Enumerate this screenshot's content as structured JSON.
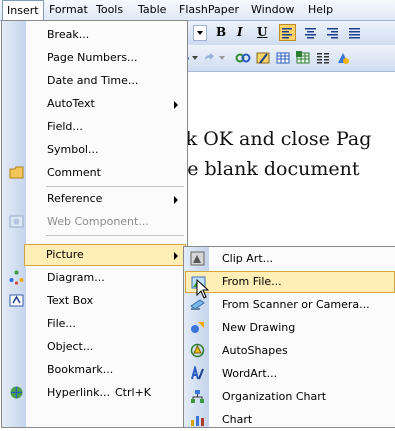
{
  "menubar": {
    "items": [
      "Insert",
      "Format",
      "Tools",
      "Table",
      "FlashPaper",
      "Window",
      "Help"
    ]
  },
  "toolbar": {
    "font_size_fragment": "2",
    "bold": "B",
    "italic": "I",
    "underline": "U"
  },
  "document": {
    "line1": "ck OK and close Pag",
    "line2": "he blank document"
  },
  "insert_menu": {
    "items": [
      {
        "label": "Break...",
        "icon": "none"
      },
      {
        "label": "Page Numbers...",
        "icon": "none"
      },
      {
        "label": "Date and Time...",
        "icon": "none"
      },
      {
        "label": "AutoText",
        "icon": "none",
        "submenu": true
      },
      {
        "label": "Field...",
        "icon": "none"
      },
      {
        "label": "Symbol...",
        "icon": "none"
      },
      {
        "label": "Comment",
        "icon": "comment-icon"
      },
      {
        "label": "Reference",
        "icon": "none",
        "submenu": true
      },
      {
        "label": "Web Component...",
        "icon": "web-component-icon",
        "disabled": true
      },
      {
        "label": "Picture",
        "icon": "none",
        "submenu": true,
        "highlighted": true
      },
      {
        "label": "Diagram...",
        "icon": "diagram-icon"
      },
      {
        "label": "Text Box",
        "icon": "text-box-icon"
      },
      {
        "label": "File...",
        "icon": "none"
      },
      {
        "label": "Object...",
        "icon": "none"
      },
      {
        "label": "Bookmark...",
        "icon": "none"
      },
      {
        "label": "Hyperlink...",
        "icon": "hyperlink-icon",
        "shortcut": "Ctrl+K"
      }
    ]
  },
  "picture_menu": {
    "items": [
      {
        "label": "Clip Art...",
        "icon": "clip-art-icon"
      },
      {
        "label": "From File...",
        "icon": "from-file-icon",
        "highlighted": true
      },
      {
        "label": "From Scanner or Camera...",
        "icon": "scanner-icon"
      },
      {
        "label": "New Drawing",
        "icon": "new-drawing-icon"
      },
      {
        "label": "AutoShapes",
        "icon": "autoshapes-icon"
      },
      {
        "label": "WordArt...",
        "icon": "wordart-icon"
      },
      {
        "label": "Organization Chart",
        "icon": "org-chart-icon"
      },
      {
        "label": "Chart",
        "icon": "chart-icon"
      }
    ]
  },
  "colors": {
    "highlight_fill": "#ffeeb5",
    "highlight_border": "#d7a443",
    "menu_strip": "#c4d4ec",
    "disabled_text": "#8d8d8d"
  }
}
